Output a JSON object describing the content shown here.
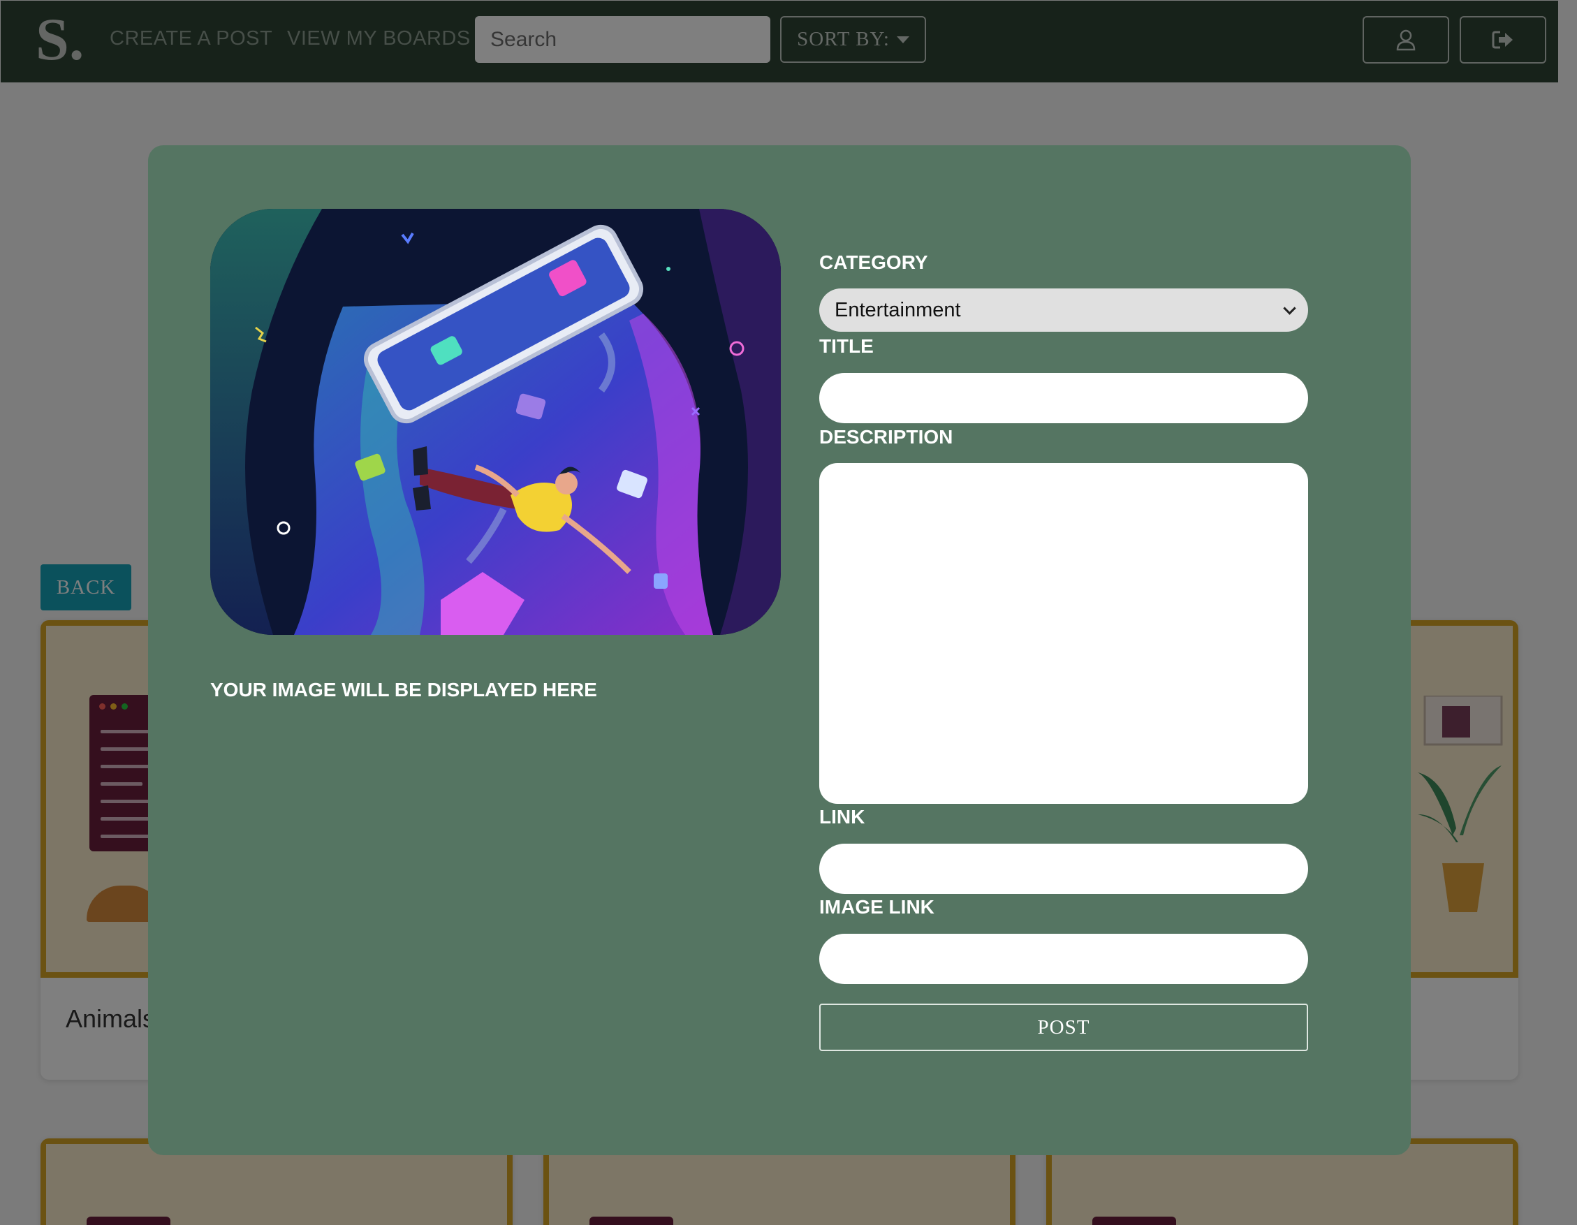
{
  "navbar": {
    "logo_text": "S.",
    "create_post": "CREATE A POST",
    "view_boards": "VIEW MY BOARDS",
    "search_placeholder": "Search",
    "sort_label": "SORT BY:",
    "user_icon": "user-icon",
    "logout_icon": "sign-out-icon"
  },
  "page": {
    "back_label": "BACK",
    "cards": [
      {
        "title": "Animals"
      },
      {
        "title": ""
      },
      {
        "title": ""
      },
      {
        "title": ""
      },
      {
        "title": ""
      }
    ]
  },
  "modal": {
    "preview_caption": "YOUR IMAGE WILL BE DISPLAYED HERE",
    "category_label": "CATEGORY",
    "category_value": "Entertainment",
    "title_label": "TITLE",
    "title_value": "",
    "description_label": "DESCRIPTION",
    "description_value": "",
    "link_label": "LINK",
    "link_value": "",
    "image_link_label": "IMAGE LINK",
    "image_link_value": "",
    "post_label": "POST"
  },
  "colors": {
    "navbar_bg": "#2f4434",
    "modal_bg": "#557562",
    "back_button": "#17a2b8",
    "card_frame": "#d6a524",
    "card_fill": "#fbeccc"
  }
}
